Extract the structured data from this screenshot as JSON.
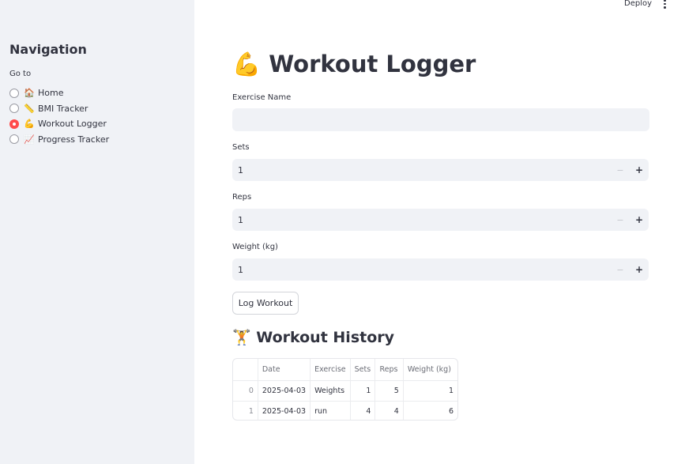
{
  "header": {
    "deploy_label": "Deploy",
    "menu_icon": "kebab-icon"
  },
  "sidebar": {
    "title": "Navigation",
    "radio_label": "Go to",
    "items": [
      {
        "emoji": "🏠",
        "label": "Home",
        "selected": false
      },
      {
        "emoji": "📏",
        "label": "BMI Tracker",
        "selected": false
      },
      {
        "emoji": "💪",
        "label": "Workout Logger",
        "selected": true
      },
      {
        "emoji": "📈",
        "label": "Progress Tracker",
        "selected": false
      }
    ]
  },
  "main": {
    "title_emoji": "💪",
    "title": "Workout Logger",
    "fields": {
      "exercise": {
        "label": "Exercise Name",
        "value": "",
        "placeholder": ""
      },
      "sets": {
        "label": "Sets",
        "value": "1"
      },
      "reps": {
        "label": "Reps",
        "value": "1"
      },
      "weight": {
        "label": "Weight (kg)",
        "value": "1"
      }
    },
    "stepper": {
      "minus": "−",
      "plus": "+"
    },
    "log_button": "Log Workout",
    "history_emoji": "🏋️",
    "history_title": "Workout History",
    "table": {
      "columns": [
        "",
        "Date",
        "Exercise",
        "Sets",
        "Reps",
        "Weight (kg)"
      ],
      "rows": [
        [
          "0",
          "2025-04-03",
          "Weights",
          "1",
          "5",
          "1"
        ],
        [
          "1",
          "2025-04-03",
          "run",
          "4",
          "4",
          "6"
        ]
      ]
    }
  }
}
